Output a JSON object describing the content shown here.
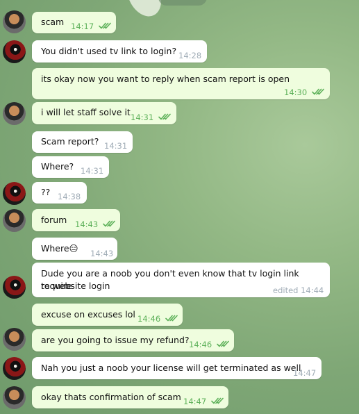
{
  "messages": [
    {
      "dir": "out",
      "text": "scam",
      "time": "14:17",
      "read": true
    },
    {
      "dir": "in",
      "text": "You didn't used tv link to login?",
      "time": "14:28"
    },
    {
      "dir": "out",
      "text": "its okay now you want to reply when scam report is open",
      "time": "14:30",
      "read": true
    },
    {
      "dir": "out",
      "text": "i will let staff solve it",
      "time": "14:31",
      "read": true
    },
    {
      "dir": "in",
      "text": "Scam report?",
      "time": "14:31"
    },
    {
      "dir": "in",
      "text": "Where?",
      "time": "14:31"
    },
    {
      "dir": "in",
      "text": "??",
      "time": "14:38"
    },
    {
      "dir": "out",
      "text": "forum",
      "time": "14:43",
      "read": true
    },
    {
      "dir": "in",
      "text": "Where",
      "emoji": "😑",
      "time": "14:43"
    },
    {
      "dir": "in",
      "text_line1": "Dude you are a noob you don't even know that tv login link require",
      "text_line2": "to website login",
      "time": "edited 14:44"
    },
    {
      "dir": "out",
      "text": "excuse on excuses lol",
      "time": "14:46",
      "read": true
    },
    {
      "dir": "out",
      "text": "are you going to issue my refund?",
      "time": "14:46",
      "read": true
    },
    {
      "dir": "in",
      "text": "Nah you just a noob your license will get terminated as well",
      "time": "14:47"
    },
    {
      "dir": "out",
      "text": "okay thats confirmation of scam",
      "time": "14:47",
      "read": true
    }
  ],
  "icons": {
    "read_receipt": "double-check-icon"
  },
  "colors": {
    "outgoing_bubble": "#effdde",
    "incoming_bubble": "#ffffff",
    "outgoing_time": "#5eb15a",
    "incoming_time": "#a0acb6"
  }
}
